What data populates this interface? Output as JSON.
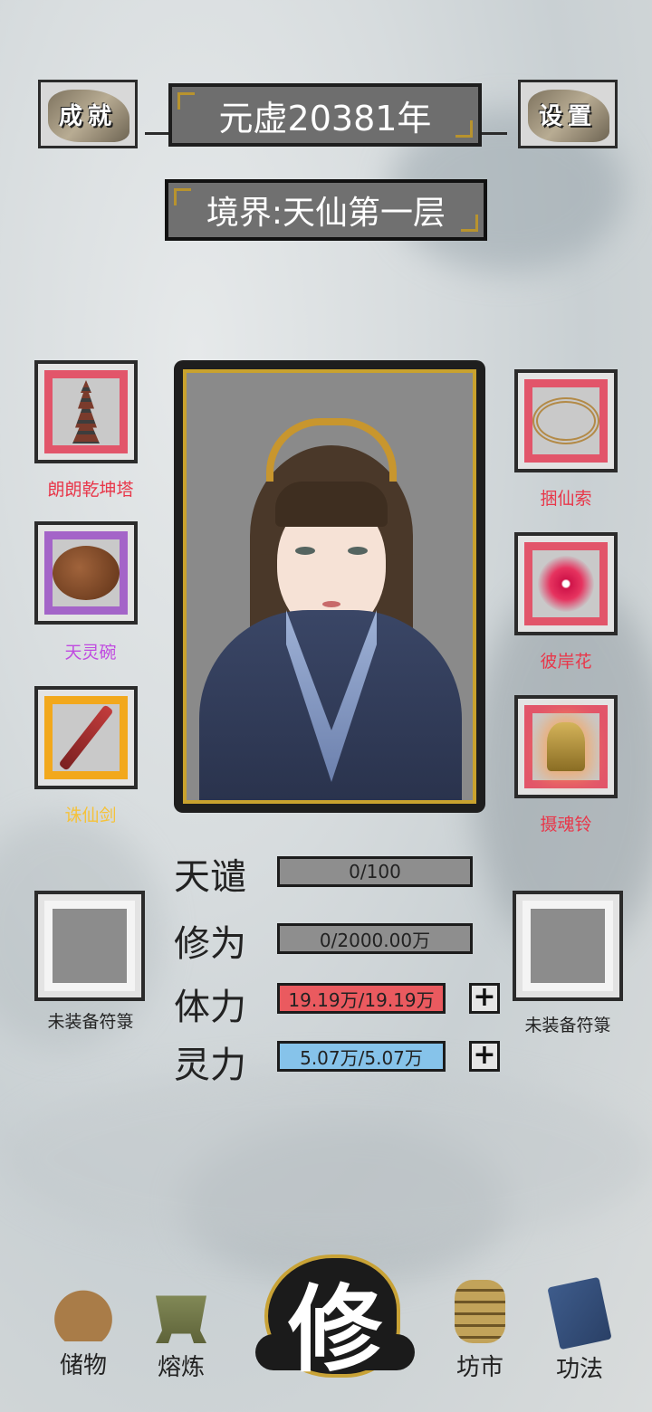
{
  "header": {
    "achievement_label": "成就",
    "settings_label": "设置",
    "year": "元虚20381年",
    "realm": "境界:天仙第一层"
  },
  "left_equipment": [
    {
      "name": "朗朗乾坤塔",
      "rarity": "red"
    },
    {
      "name": "天灵碗",
      "rarity": "purple"
    },
    {
      "name": "诛仙剑",
      "rarity": "gold"
    }
  ],
  "right_equipment": [
    {
      "name": "捆仙索",
      "rarity": "red"
    },
    {
      "name": "彼岸花",
      "rarity": "red"
    },
    {
      "name": "摄魂铃",
      "rarity": "red"
    }
  ],
  "talisman_slots": {
    "left_label": "未装备符箓",
    "right_label": "未装备符箓"
  },
  "stats": {
    "tribulation": {
      "label": "天谴",
      "value": "0/100",
      "fill": 0.0
    },
    "cultivation": {
      "label": "修为",
      "value": "0/2000.00万",
      "fill": 0.0
    },
    "stamina": {
      "label": "体力",
      "value": "19.19万/19.19万",
      "fill": 1.0
    },
    "spirit": {
      "label": "灵力",
      "value": "5.07万/5.07万",
      "fill": 1.0
    },
    "plus_symbol": "+"
  },
  "bottom_nav": {
    "storage": "储物",
    "smelting": "熔炼",
    "cultivate": "修",
    "market": "坊市",
    "techniques": "功法"
  },
  "colors": {
    "red_rarity": "#e2556a",
    "purple_rarity": "#a464c8",
    "gold_rarity": "#f2a81c",
    "stamina_bar": "#ea5a5f",
    "spirit_bar": "#86c3ea",
    "neutral_bar": "#8e8e8e"
  }
}
